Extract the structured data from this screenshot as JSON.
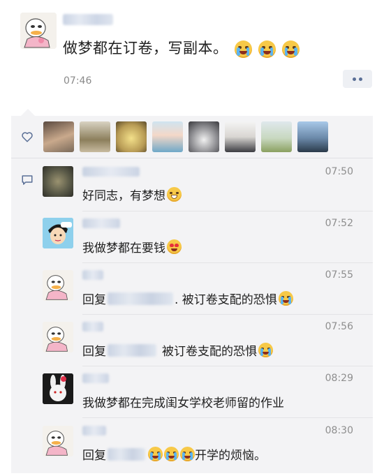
{
  "post": {
    "text": "做梦都在订卷，写副本。",
    "time": "07:46"
  },
  "likes": {
    "icon": "heart-outline-icon",
    "avatars": [
      {
        "name": "like-avatar-1",
        "color": "#8a7a6c"
      },
      {
        "name": "like-avatar-2",
        "color": "#b8b2a0"
      },
      {
        "name": "like-avatar-3",
        "color": "#b89b55"
      },
      {
        "name": "like-avatar-4",
        "color": "#9fb7c8"
      },
      {
        "name": "like-avatar-5",
        "color": "#6c6c70"
      },
      {
        "name": "like-avatar-6",
        "color": "#d9d6d2"
      },
      {
        "name": "like-avatar-7",
        "color": "#a8b878"
      },
      {
        "name": "like-avatar-8",
        "color": "#6a88a8"
      }
    ]
  },
  "comments": [
    {
      "time": "07:50",
      "text": "好同志，有梦想",
      "emoji": "grin"
    },
    {
      "time": "07:52",
      "text": "我做梦都在要钱",
      "emoji": "heart-eyes"
    },
    {
      "time": "07:55",
      "prefix": "回复",
      "text": ". 被订卷支配的恐惧",
      "emoji": "crying"
    },
    {
      "time": "07:56",
      "prefix": "回复",
      "text": "被订卷支配的恐惧",
      "emoji": "crying"
    },
    {
      "time": "08:29",
      "text": "我做梦都在完成闺女学校老师留的作业"
    },
    {
      "time": "08:30",
      "prefix": "回复",
      "text": "开学的烦恼。",
      "emoji": "loudly-crying"
    }
  ]
}
